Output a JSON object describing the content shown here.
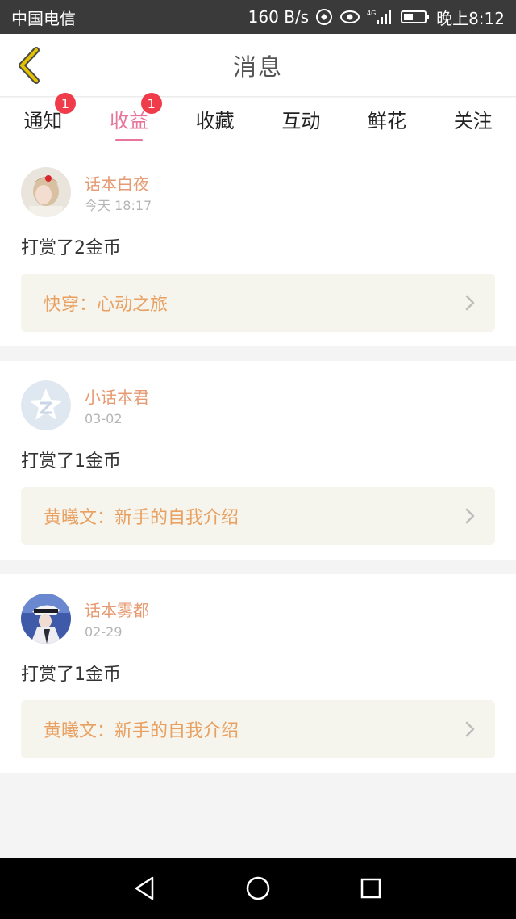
{
  "status_bar": {
    "carrier": "中国电信",
    "net_speed": "160 B/s",
    "network_label": "4G",
    "time": "晚上8:12"
  },
  "header": {
    "title": "消息",
    "back_icon": "chevron-left-icon",
    "accent_color": "#d6b400"
  },
  "tabs": [
    {
      "label": "通知",
      "badge": "1",
      "active": false
    },
    {
      "label": "收益",
      "badge": "1",
      "active": true
    },
    {
      "label": "收藏",
      "badge": "",
      "active": false
    },
    {
      "label": "互动",
      "badge": "",
      "active": false
    },
    {
      "label": "鲜花",
      "badge": "",
      "active": false
    },
    {
      "label": "关注",
      "badge": "",
      "active": false
    }
  ],
  "colors": {
    "active_tab": "#e7749c",
    "badge": "#ef3b4a",
    "username": "#e59a72",
    "link_text": "#e9a061",
    "link_bg": "#f5f4ed"
  },
  "items": [
    {
      "username": "话本白夜",
      "time": "今天 18:17",
      "message": "打赏了2金币",
      "link": "快穿：心动之旅",
      "avatar": "user-avatar-photo"
    },
    {
      "username": "小话本君",
      "time": "03-02",
      "message": "打赏了1金币",
      "link": "黄曦文：新手的自我介绍",
      "avatar": "default-qq-avatar"
    },
    {
      "username": "话本雾都",
      "time": "02-29",
      "message": "打赏了1金币",
      "link": "黄曦文：新手的自我介绍",
      "avatar": "user-avatar-photo"
    }
  ],
  "nav_bar": {
    "back": "triangle-back-icon",
    "home": "circle-home-icon",
    "recents": "square-recents-icon"
  }
}
